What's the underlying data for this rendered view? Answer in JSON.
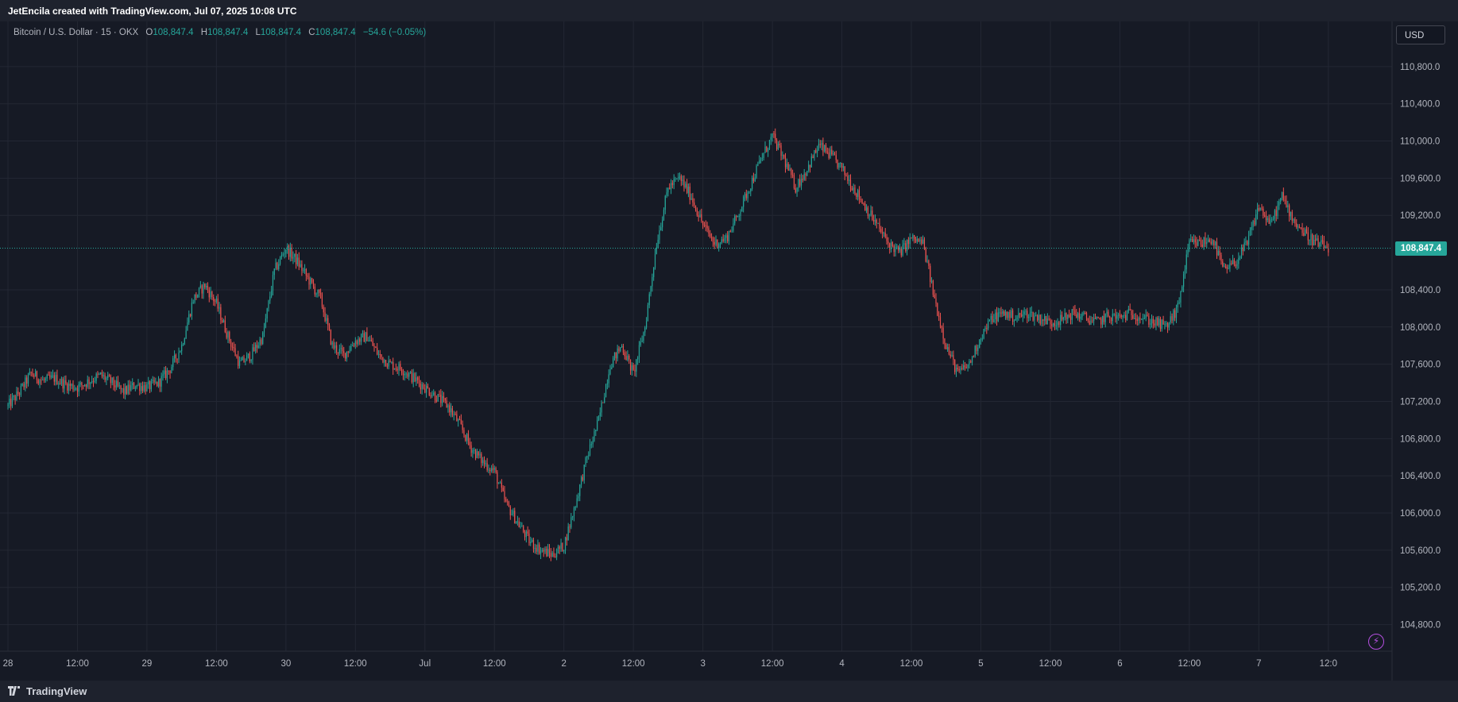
{
  "header": {
    "attribution": "JetEncila created with TradingView.com, Jul 07, 2025 10:08 UTC"
  },
  "legend": {
    "symbol": "Bitcoin / U.S. Dollar · 15 · OKX",
    "open_label": "O",
    "open_value": "108,847.4",
    "high_label": "H",
    "high_value": "108,847.4",
    "low_label": "L",
    "low_value": "108,847.4",
    "close_label": "C",
    "close_value": "108,847.4",
    "change": "−54.6 (−0.05%)"
  },
  "currency_button": "USD",
  "last_price_label": "108,847.4",
  "footer": {
    "brand": "TradingView"
  },
  "colors": {
    "up": "#26a69a",
    "down": "#ef5350",
    "background": "#161a25",
    "grid": "#232733",
    "price_line": "#26a69a"
  },
  "chart_data": {
    "type": "candlestick",
    "title": "Bitcoin / U.S. Dollar · 15 · OKX",
    "interval": "15",
    "ylim": [
      104600,
      111200
    ],
    "y_ticks": [
      {
        "value": 104800,
        "label": "104,800.0"
      },
      {
        "value": 105200,
        "label": "105,200.0"
      },
      {
        "value": 105600,
        "label": "105,600.0"
      },
      {
        "value": 106000,
        "label": "106,000.0"
      },
      {
        "value": 106400,
        "label": "106,400.0"
      },
      {
        "value": 106800,
        "label": "106,800.0"
      },
      {
        "value": 107200,
        "label": "107,200.0"
      },
      {
        "value": 107600,
        "label": "107,600.0"
      },
      {
        "value": 108000,
        "label": "108,000.0"
      },
      {
        "value": 108400,
        "label": "108,400.0"
      },
      {
        "value": 109200,
        "label": "109,200.0"
      },
      {
        "value": 109600,
        "label": "109,600.0"
      },
      {
        "value": 110000,
        "label": "110,000.0"
      },
      {
        "value": 110400,
        "label": "110,400.0"
      },
      {
        "value": 110800,
        "label": "110,800.0"
      }
    ],
    "x_ticks": [
      {
        "t": 0,
        "label": "28"
      },
      {
        "t": 12,
        "label": "12:00"
      },
      {
        "t": 24,
        "label": "29"
      },
      {
        "t": 36,
        "label": "12:00"
      },
      {
        "t": 48,
        "label": "30"
      },
      {
        "t": 60,
        "label": "12:00"
      },
      {
        "t": 72,
        "label": "Jul"
      },
      {
        "t": 84,
        "label": "12:00"
      },
      {
        "t": 96,
        "label": "2"
      },
      {
        "t": 108,
        "label": "12:00"
      },
      {
        "t": 120,
        "label": "3"
      },
      {
        "t": 132,
        "label": "12:00"
      },
      {
        "t": 144,
        "label": "4"
      },
      {
        "t": 156,
        "label": "12:00"
      },
      {
        "t": 168,
        "label": "5"
      },
      {
        "t": 180,
        "label": "12:00"
      },
      {
        "t": 192,
        "label": "6"
      },
      {
        "t": 204,
        "label": "12:00"
      },
      {
        "t": 216,
        "label": "7"
      },
      {
        "t": 228,
        "label": "12:0"
      }
    ],
    "x_unit": "hours since Jun 28 00:00",
    "last_price": 108847.4,
    "price_path": [
      [
        0,
        107150
      ],
      [
        2,
        107300
      ],
      [
        4,
        107500
      ],
      [
        6,
        107420
      ],
      [
        8,
        107450
      ],
      [
        10,
        107380
      ],
      [
        12,
        107350
      ],
      [
        14,
        107420
      ],
      [
        16,
        107480
      ],
      [
        18,
        107400
      ],
      [
        20,
        107300
      ],
      [
        22,
        107380
      ],
      [
        24,
        107350
      ],
      [
        26,
        107400
      ],
      [
        28,
        107550
      ],
      [
        30,
        107800
      ],
      [
        32,
        108300
      ],
      [
        34,
        108450
      ],
      [
        36,
        108250
      ],
      [
        38,
        107900
      ],
      [
        40,
        107600
      ],
      [
        42,
        107700
      ],
      [
        44,
        107900
      ],
      [
        46,
        108600
      ],
      [
        48,
        108850
      ],
      [
        50,
        108700
      ],
      [
        52,
        108500
      ],
      [
        54,
        108300
      ],
      [
        56,
        107800
      ],
      [
        58,
        107700
      ],
      [
        60,
        107850
      ],
      [
        62,
        107900
      ],
      [
        64,
        107700
      ],
      [
        66,
        107600
      ],
      [
        68,
        107550
      ],
      [
        70,
        107450
      ],
      [
        72,
        107350
      ],
      [
        74,
        107250
      ],
      [
        76,
        107150
      ],
      [
        78,
        106950
      ],
      [
        80,
        106700
      ],
      [
        82,
        106550
      ],
      [
        84,
        106450
      ],
      [
        86,
        106100
      ],
      [
        88,
        105900
      ],
      [
        90,
        105700
      ],
      [
        92,
        105600
      ],
      [
        94,
        105550
      ],
      [
        96,
        105650
      ],
      [
        98,
        106100
      ],
      [
        100,
        106600
      ],
      [
        102,
        107000
      ],
      [
        104,
        107600
      ],
      [
        106,
        107800
      ],
      [
        108,
        107500
      ],
      [
        110,
        108000
      ],
      [
        112,
        108900
      ],
      [
        114,
        109500
      ],
      [
        116,
        109600
      ],
      [
        118,
        109400
      ],
      [
        120,
        109100
      ],
      [
        122,
        108900
      ],
      [
        124,
        108950
      ],
      [
        126,
        109200
      ],
      [
        128,
        109500
      ],
      [
        130,
        109800
      ],
      [
        132,
        110050
      ],
      [
        134,
        109800
      ],
      [
        136,
        109500
      ],
      [
        138,
        109700
      ],
      [
        140,
        109950
      ],
      [
        142,
        109850
      ],
      [
        144,
        109700
      ],
      [
        146,
        109500
      ],
      [
        148,
        109300
      ],
      [
        150,
        109100
      ],
      [
        152,
        108900
      ],
      [
        154,
        108800
      ],
      [
        156,
        108950
      ],
      [
        158,
        108900
      ],
      [
        160,
        108300
      ],
      [
        162,
        107800
      ],
      [
        164,
        107500
      ],
      [
        166,
        107600
      ],
      [
        168,
        107900
      ],
      [
        170,
        108100
      ],
      [
        172,
        108150
      ],
      [
        174,
        108100
      ],
      [
        176,
        108150
      ],
      [
        178,
        108100
      ],
      [
        180,
        108050
      ],
      [
        182,
        108080
      ],
      [
        184,
        108150
      ],
      [
        186,
        108100
      ],
      [
        188,
        108050
      ],
      [
        190,
        108120
      ],
      [
        192,
        108100
      ],
      [
        194,
        108150
      ],
      [
        196,
        108100
      ],
      [
        198,
        108050
      ],
      [
        200,
        108000
      ],
      [
        202,
        108200
      ],
      [
        204,
        108900
      ],
      [
        206,
        108900
      ],
      [
        208,
        108950
      ],
      [
        210,
        108600
      ],
      [
        212,
        108700
      ],
      [
        214,
        108900
      ],
      [
        216,
        109300
      ],
      [
        218,
        109100
      ],
      [
        220,
        109400
      ],
      [
        222,
        109150
      ],
      [
        224,
        109000
      ],
      [
        226,
        108900
      ],
      [
        228,
        108847
      ]
    ],
    "grid": true,
    "legend_position": "top-left"
  }
}
